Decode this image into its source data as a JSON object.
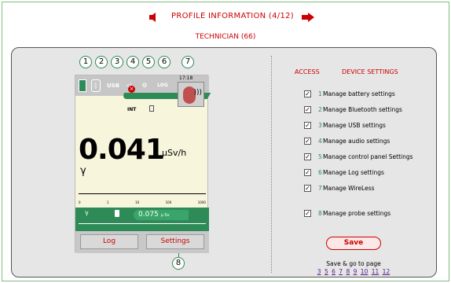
{
  "nav": {
    "title": "PROFILE INFORMATION (4/12)",
    "subtitle": "TECHNICIAN (66)"
  },
  "device": {
    "time": "17:18",
    "usb": "USB",
    "log_icon": "LOG",
    "int_label": "INT",
    "reading": "0.041",
    "unit": "μSv/h",
    "gamma": "γ",
    "scale_labels": [
      "0",
      "1",
      "10",
      "100",
      "1000"
    ],
    "bar_gamma": "γ",
    "bar_reading": "0.075",
    "bar_unit": "μ Sv",
    "softkey_log": "Log",
    "softkey_settings": "Settings"
  },
  "callouts": [
    "1",
    "2",
    "3",
    "4",
    "5",
    "6",
    "7",
    "8"
  ],
  "settings": {
    "access_header": "ACCESS",
    "device_header": "DEVICE SETTINGS",
    "items": [
      {
        "num": "1",
        "label": "Manage battery settings",
        "checked": true
      },
      {
        "num": "2",
        "label": "Manage Bluetooth settings",
        "checked": true
      },
      {
        "num": "3",
        "label": "Manage USB settings",
        "checked": true
      },
      {
        "num": "4",
        "label": "Manage audio settings",
        "checked": true
      },
      {
        "num": "5",
        "label": "Manage control panel Settings",
        "checked": true
      },
      {
        "num": "6",
        "label": "Manage Log settings",
        "checked": true
      },
      {
        "num": "7",
        "label": "Manage WireLess",
        "checked": true
      },
      {
        "num": "8",
        "label": "Manage probe settings",
        "checked": true
      }
    ],
    "save_label": "Save",
    "save_go_label": "Save & go to page",
    "pages": [
      "3",
      "5",
      "6",
      "7",
      "8",
      "9",
      "10",
      "11",
      "12"
    ]
  },
  "colors": {
    "accent": "#cc0000",
    "green": "#2e8b57",
    "link": "#551a8b"
  }
}
